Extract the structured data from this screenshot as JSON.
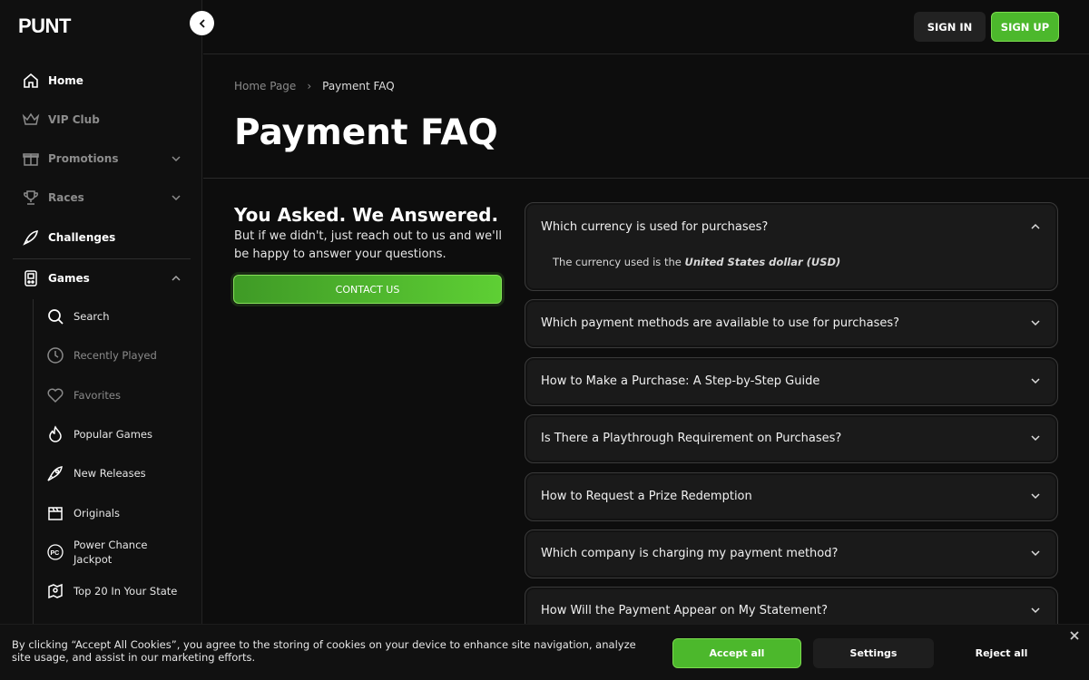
{
  "brand": {
    "logo_text": "PUNT",
    "accent": "#4cb82c"
  },
  "sidebar": {
    "items": [
      {
        "label": "Home",
        "icon": "home-icon"
      },
      {
        "label": "VIP Club",
        "icon": "crown-icon"
      },
      {
        "label": "Promotions",
        "icon": "gift-icon"
      },
      {
        "label": "Races",
        "icon": "trophy-icon"
      },
      {
        "label": "Challenges",
        "icon": "rocket-icon"
      },
      {
        "label": "Games",
        "icon": "gamepad-icon"
      }
    ],
    "games_sub": [
      {
        "label": "Search",
        "icon": "search-icon"
      },
      {
        "label": "Recently Played",
        "icon": "clock-icon"
      },
      {
        "label": "Favorites",
        "icon": "heart-icon"
      },
      {
        "label": "Popular Games",
        "icon": "fire-icon"
      },
      {
        "label": "New Releases",
        "icon": "rocket-icon"
      },
      {
        "label": "Originals",
        "icon": "clapper-icon"
      },
      {
        "label": "Power Chance Jackpot",
        "icon": "pc-icon"
      },
      {
        "label": "Top 20 In Your State",
        "icon": "map-pin-icon"
      }
    ]
  },
  "header": {
    "signin_label": "SIGN IN",
    "signup_label": "SIGN UP"
  },
  "breadcrumb": {
    "home": "Home Page",
    "sep": "›",
    "current": "Payment FAQ"
  },
  "page": {
    "title": "Payment FAQ",
    "ask_title": "You Asked. We Answered.",
    "ask_text": "But if we didn't, just reach out to us and we'll be happy to answer your questions.",
    "contact_label": "CONTACT US"
  },
  "faq": [
    {
      "q": "Which currency is used for purchases?",
      "expanded": true,
      "answer_prefix": "The currency used is the ",
      "answer_emph": "United States dollar (USD)"
    },
    {
      "q": "Which payment methods are available to use for purchases?",
      "expanded": false
    },
    {
      "q": "How to Make a Purchase: A Step-by-Step Guide",
      "expanded": false
    },
    {
      "q": "Is There a Playthrough Requirement on Purchases?",
      "expanded": false
    },
    {
      "q": "How to Request a Prize Redemption",
      "expanded": false
    },
    {
      "q": "Which company is charging my payment method?",
      "expanded": false
    },
    {
      "q": "How Will the Payment Appear on My Statement?",
      "expanded": false
    }
  ],
  "cookie": {
    "text": "By clicking “Accept All Cookies”, you agree to the storing of cookies on your device to enhance site navigation, analyze site usage, and assist in our marketing efforts.",
    "accept_label": "Accept all",
    "settings_label": "Settings",
    "reject_label": "Reject all"
  }
}
